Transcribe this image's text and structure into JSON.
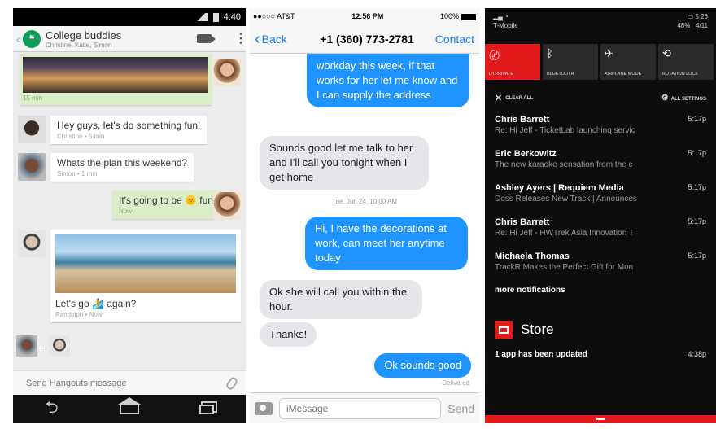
{
  "hangouts": {
    "status": {
      "time": "4:40"
    },
    "header": {
      "title": "College buddies",
      "subtitle": "Christine, Katie, Simon"
    },
    "messages": [
      {
        "text": "",
        "meta": "15 min"
      },
      {
        "text": "Hey guys, let's do something fun!",
        "meta": "Christine • 5 min"
      },
      {
        "text": "Whats the plan this weekend?",
        "meta": "Simon • 1 min"
      },
      {
        "text": "It's going to be 🌞 fun!",
        "meta": "Now"
      },
      {
        "text": "Let's go 🏄 again?",
        "meta": "Randolph • Now"
      }
    ],
    "participants_more": "...",
    "input_placeholder": "Send Hangouts message",
    "nav": {
      "back": "⮌"
    }
  },
  "imessage": {
    "status": {
      "carrier": "●●○○○ AT&T",
      "time": "12:56 PM",
      "battery": "100%"
    },
    "nav": {
      "back": "Back",
      "back_chev": "‹",
      "title": "+1 (360) 773-2781",
      "contact": "Contact"
    },
    "messages": [
      {
        "text": "workday this week, if that works for her let me know and I can supply the address"
      },
      {
        "text": "Sounds good let me talk to her and I'll call you tonight when I get home"
      },
      {
        "text": "Hi, I have the decorations at work, can meet her anytime today"
      },
      {
        "text": "Ok she will call you within the hour."
      },
      {
        "text": "Thanks!"
      },
      {
        "text": "Ok sounds good"
      }
    ],
    "datestamp": "Tue, Jun 24, 10:00 AM",
    "delivered": "Delivered",
    "input_placeholder": "iMessage",
    "send": "Send"
  },
  "actioncenter": {
    "status": {
      "carrier": "T-Mobile",
      "battery": "48%",
      "time": "5:26",
      "date": "4/11"
    },
    "tiles": [
      {
        "label": "DTPRIVATE",
        "icon": "〄",
        "active": true
      },
      {
        "label": "BLUETOOTH",
        "icon": "ᛒ",
        "active": false
      },
      {
        "label": "AIRPLANE MODE",
        "icon": "✈",
        "active": false
      },
      {
        "label": "ROTATION LOCK",
        "icon": "⟲",
        "active": false
      }
    ],
    "clear_all": "CLEAR ALL",
    "all_settings": "ALL SETTINGS",
    "notifications": [
      {
        "sender": "Chris Barrett",
        "time": "5:17p",
        "preview": "Re: Hi Jeff - TicketLab launching servic"
      },
      {
        "sender": "Eric Berkowitz",
        "time": "5:17p",
        "preview": "The new karaoke sensation from the c"
      },
      {
        "sender": "Ashley Ayers | Requiem Media",
        "time": "5:17p",
        "preview": "Doss Releases New Track | Announces"
      },
      {
        "sender": "Chris Barrett",
        "time": "5:17p",
        "preview": "Re: Hi Jeff - HWTrek Asia Innovation T"
      },
      {
        "sender": "Michaela Thomas",
        "time": "5:17p",
        "preview": "TrackR Makes the Perfect Gift for Mon"
      }
    ],
    "more_notifications": "more notifications",
    "store": {
      "name": "Store",
      "update": "1 app has been updated",
      "time": "4:38p"
    }
  }
}
